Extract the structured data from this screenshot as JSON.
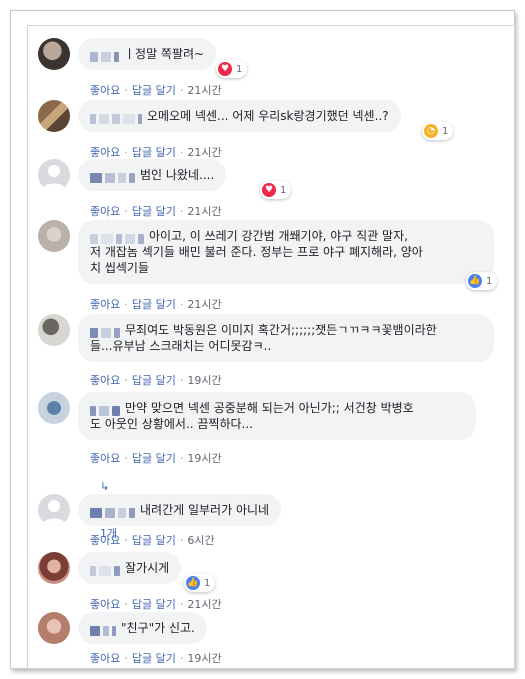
{
  "comments": [
    {
      "text": "ㅣ정말 쪽팔려~",
      "reaction_count": "1",
      "like": "좋아요",
      "reply": "답글 달기",
      "time": "21시간",
      "reaction": "heart-icon"
    },
    {
      "text": "오메오메 넥센... 어제 우리sk랑경기했던 넥센..?",
      "reaction_count": "1",
      "like": "좋아요",
      "reply": "답글 달기",
      "time": "21시간",
      "reaction": "angry-icon"
    },
    {
      "text": "범인 나왔네....",
      "reaction_count": "1",
      "like": "좋아요",
      "reply": "답글 달기",
      "time": "21시간",
      "reaction": "heart-icon"
    },
    {
      "line1": "아이고, 이 쓰레기 강간범 개쐐기야, 야구 직관 말자,",
      "line2": "저 개잡놈 섹기들 배민 불러 준다. 정부는 프로 야구 폐지해라, 양아",
      "line3": "치 씹섹기들",
      "reaction_count": "1",
      "like": "좋아요",
      "reply": "답글 달기",
      "time": "21시간",
      "reaction": "like-icon"
    },
    {
      "line1": "무죄여도 박동원은 이미지 혹간거;;;;;;잿든ㄱㄲㅋㅋ꽃뱀이라한",
      "line2": "들...유부남 스크래치는 어디못감ㅋ..",
      "like": "좋아요",
      "reply": "답글 달기",
      "time": "19시간"
    },
    {
      "line1": "만약 맞으면 넥센 공중분해 되는거 아닌가;; 서건창 박병호",
      "line2": "도 아웃인 상황에서.. 끔찍하다...",
      "like": "좋아요",
      "reply": "답글 달기",
      "time": "19시간",
      "replies": "답글 1개"
    },
    {
      "text": "내려간게 일부러가 아니네",
      "like": "좋아요",
      "reply": "답글 달기",
      "time": "6시간"
    },
    {
      "text": "잘가시게",
      "reaction_count": "1",
      "like": "좋아요",
      "reply": "답글 달기",
      "time": "21시간",
      "reaction": "like-icon"
    },
    {
      "text": "\"친구\"가 신고.",
      "like": "좋아요",
      "reply": "답글 달기",
      "time": "19시간"
    }
  ],
  "colors": {
    "link": "#4267b2",
    "bubble": "#f2f3f5",
    "heart": "#f0284a",
    "like": "#4a80f5",
    "angry": "#f7b125"
  }
}
